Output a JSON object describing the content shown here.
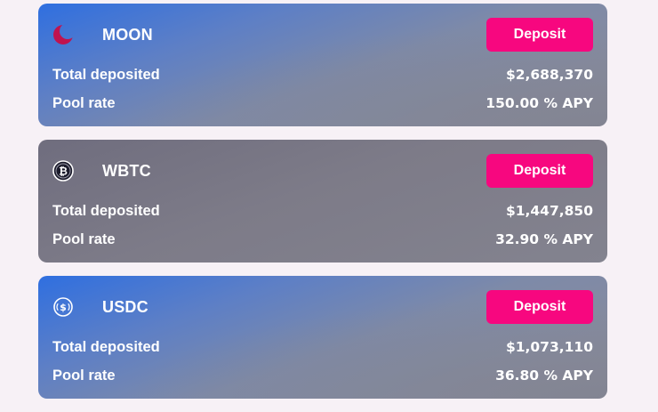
{
  "pools": [
    {
      "name": "MOON",
      "icon": "moon-icon",
      "deposit_label": "Deposit",
      "total_deposited_label": "Total deposited",
      "total_deposited_value": "$2,688,370",
      "pool_rate_label": "Pool rate",
      "pool_rate_value": "150.00 % APY"
    },
    {
      "name": "WBTC",
      "icon": "bitcoin-icon",
      "deposit_label": "Deposit",
      "total_deposited_label": "Total deposited",
      "total_deposited_value": "$1,447,850",
      "pool_rate_label": "Pool rate",
      "pool_rate_value": "32.90 % APY"
    },
    {
      "name": "USDC",
      "icon": "usdc-icon",
      "deposit_label": "Deposit",
      "total_deposited_label": "Total deposited",
      "total_deposited_value": "$1,073,110",
      "pool_rate_label": "Pool rate",
      "pool_rate_value": "36.80 % APY"
    }
  ],
  "colors": {
    "deposit_button": "#f7077f",
    "page_background": "#f7f1f6",
    "card_blue": "#2f6fe0",
    "card_grey": "#7d7b88",
    "moon_icon": "#c0134f"
  }
}
